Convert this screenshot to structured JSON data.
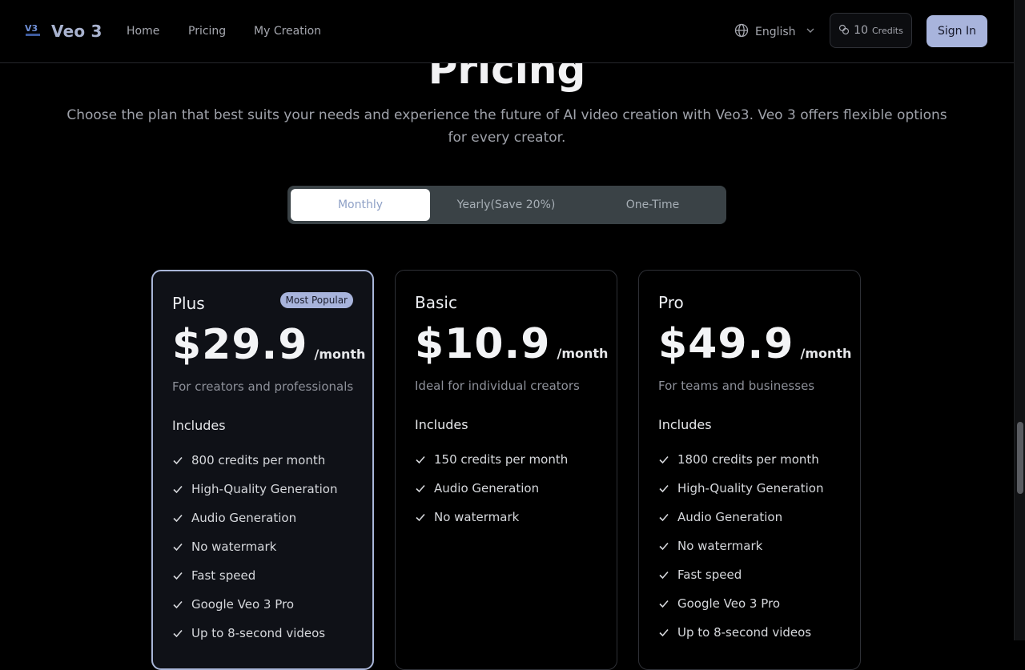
{
  "header": {
    "brand": "Veo 3",
    "nav": [
      "Home",
      "Pricing",
      "My Creation"
    ],
    "language": "English",
    "credits_count": "10",
    "credits_label": "Credits",
    "signin_label": "Sign In"
  },
  "hero": {
    "title": "Pricing",
    "subtitle": "Choose the plan that best suits your needs and experience the future of AI video creation with Veo3. Veo 3 offers flexible options for every creator."
  },
  "billing_tabs": [
    "Monthly",
    "Yearly(Save 20%)",
    "One-Time"
  ],
  "billing_selected": "Monthly",
  "plans": [
    {
      "name": "Plus",
      "badge": "Most Popular",
      "price": "$29.9",
      "period": "/month",
      "description": "For creators and professionals",
      "includes_label": "Includes",
      "features": [
        "800 credits per month",
        "High-Quality Generation",
        "Audio Generation",
        "No watermark",
        "Fast speed",
        "Google Veo 3 Pro",
        "Up to 8-second videos"
      ]
    },
    {
      "name": "Basic",
      "price": "$10.9",
      "period": "/month",
      "description": "Ideal for individual creators",
      "includes_label": "Includes",
      "features": [
        "150 credits per month",
        "Audio Generation",
        "No watermark"
      ]
    },
    {
      "name": "Pro",
      "price": "$49.9",
      "period": "/month",
      "description": "For teams and businesses",
      "includes_label": "Includes",
      "features": [
        "1800 credits per month",
        "High-Quality Generation",
        "Audio Generation",
        "No watermark",
        "Fast speed",
        "Google Veo 3 Pro",
        "Up to 8-second videos"
      ]
    }
  ],
  "icons": {
    "logo": "veo-logo-icon",
    "language": "globe-icon",
    "dropdown": "chevron-down-icon",
    "credits": "coins-icon",
    "feature": "check-icon"
  },
  "colors": {
    "accent": "#a8b4dc",
    "background": "#000000",
    "toggle_bg": "#3a4246"
  }
}
